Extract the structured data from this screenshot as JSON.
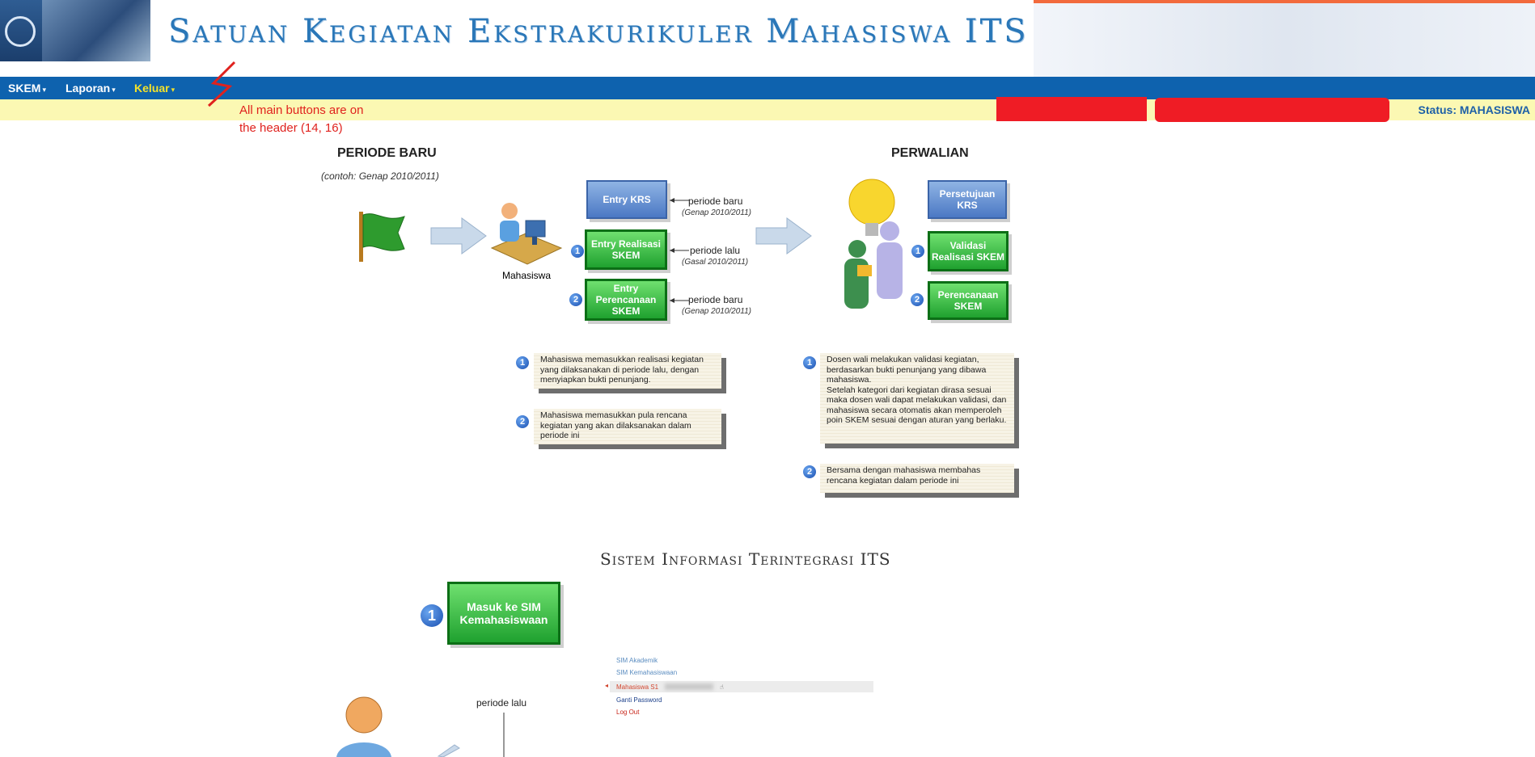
{
  "header": {
    "title": "Satuan Kegiatan Ekstrakurikuler Mahasiswa ITS",
    "colors": {
      "nav_bg": "#0e62ae",
      "status_bg": "#fbf8b3",
      "accent": "#f4e22a"
    }
  },
  "nav": {
    "items": [
      {
        "label": "SKEM",
        "icon": "chevron-down-icon"
      },
      {
        "label": "Laporan",
        "icon": "chevron-down-icon"
      },
      {
        "label": "Keluar",
        "icon": "chevron-down-icon"
      }
    ]
  },
  "statusbar": {
    "status": "Status: MAHASISWA"
  },
  "annotation": {
    "line1": "All main buttons are on",
    "line2": "the header  (14, 16)"
  },
  "diagram": {
    "left_heading": "PERIODE BARU",
    "left_sub": "(contoh: Genap 2010/2011)",
    "right_heading": "PERWALIAN",
    "mahasiswa": "Mahasiswa",
    "buttons": {
      "entry_krs": "Entry KRS",
      "entry_realisasi": "Entry Realisasi SKEM",
      "entry_perencanaan": "Entry Perencanaan SKEM",
      "persetujuan_krs": "Persetujuan KRS",
      "validasi": "Validasi Realisasi SKEM",
      "perencanaan": "Perencanaan SKEM"
    },
    "periods": [
      {
        "label": "periode baru",
        "sub": "(Genap 2010/2011)"
      },
      {
        "label": "periode lalu",
        "sub": "(Gasal 2010/2011)"
      },
      {
        "label": "periode baru",
        "sub": "(Genap 2010/2011)"
      }
    ],
    "notes_left": [
      "Mahasiswa memasukkan realisasi kegiatan yang dilaksanakan di periode lalu, dengan menyiapkan bukti penunjang.",
      "Mahasiswa memasukkan pula rencana kegiatan yang akan dilaksanakan dalam periode ini"
    ],
    "notes_right": [
      "Dosen wali melakukan validasi kegiatan, berdasarkan bukti penunjang yang dibawa mahasiswa.",
      "Setelah kategori dari kegiatan dirasa sesuai maka dosen wali dapat melakukan validasi, dan mahasiswa secara otomatis akan memperoleh poin SKEM sesuai dengan aturan yang berlaku.",
      "Bersama dengan mahasiswa membahas rencana kegiatan dalam periode ini"
    ],
    "sit_title": "Sistem Informasi Terintegrasi ITS",
    "sim_button": "Masuk ke SIM Kemahasiswaan",
    "sim_menu": [
      "SIM Akademik",
      "SIM Kemahasiswaan",
      "Mahasiswa S1",
      "Ganti Password",
      "Log Out"
    ],
    "periode_lalu": "periode lalu",
    "numbers": [
      "1",
      "2"
    ]
  }
}
